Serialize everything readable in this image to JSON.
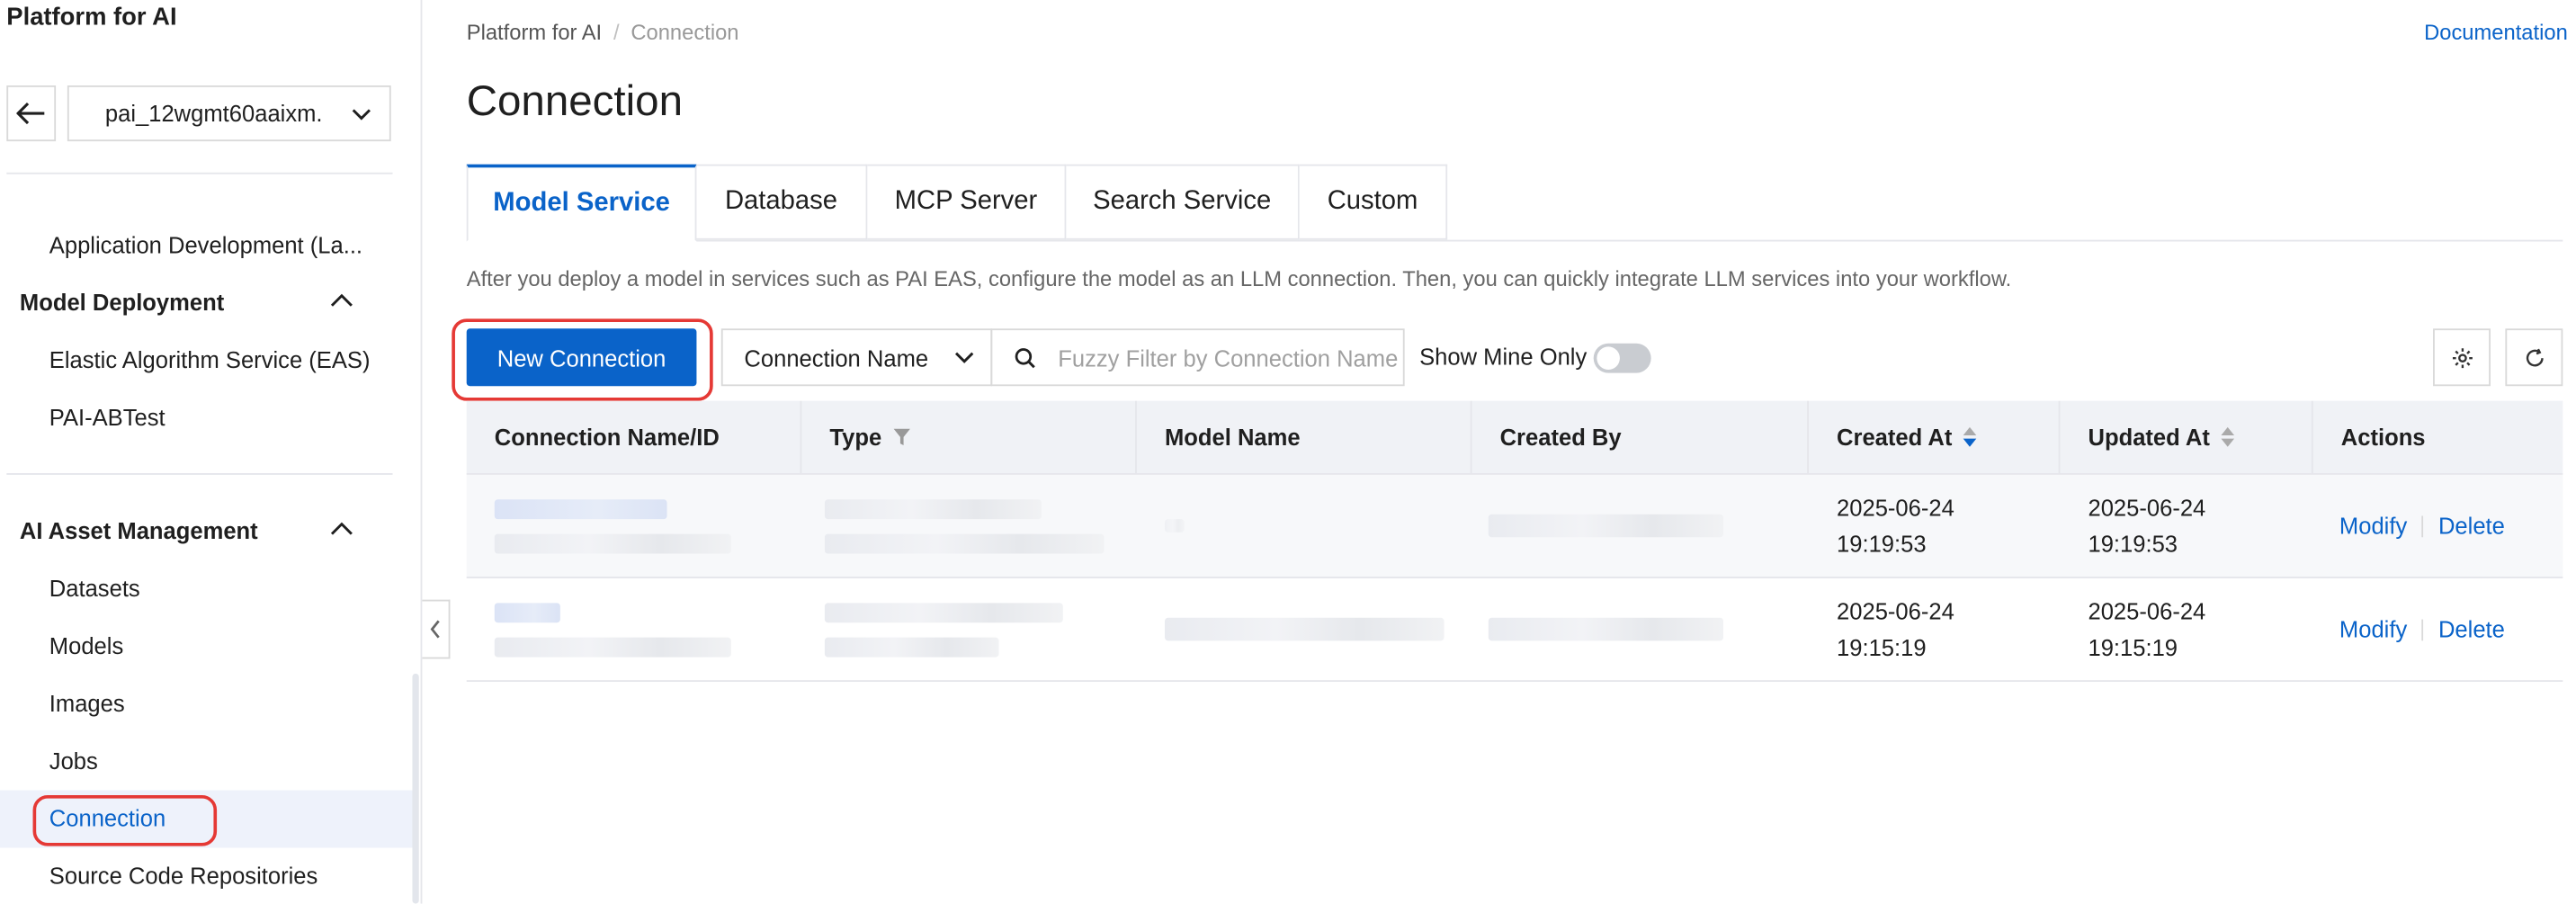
{
  "app": {
    "title": "Platform for AI"
  },
  "workspace": {
    "selected": "pai_12wgmt60aaixm."
  },
  "sidebar": {
    "items": [
      {
        "label": "Application Development (La..."
      },
      {
        "label": "Model Deployment"
      },
      {
        "label": "Elastic Algorithm Service (EAS)"
      },
      {
        "label": "PAI-ABTest"
      },
      {
        "label": "AI Asset Management"
      },
      {
        "label": "Datasets"
      },
      {
        "label": "Models"
      },
      {
        "label": "Images"
      },
      {
        "label": "Jobs"
      },
      {
        "label": "Connection"
      },
      {
        "label": "Source Code Repositories"
      }
    ]
  },
  "breadcrumb": {
    "root": "Platform for AI",
    "current": "Connection"
  },
  "header": {
    "doc_link": "Documentation",
    "title": "Connection"
  },
  "tabs": [
    {
      "label": "Model Service"
    },
    {
      "label": "Database"
    },
    {
      "label": "MCP Server"
    },
    {
      "label": "Search Service"
    },
    {
      "label": "Custom"
    }
  ],
  "description": "After you deploy a model in services such as PAI EAS, configure the model as an LLM connection. Then, you can quickly integrate LLM services into your workflow.",
  "toolbar": {
    "new_button": "New Connection",
    "filter_field": "Connection Name",
    "search_placeholder": "Fuzzy Filter by Connection Name",
    "show_mine_label": "Show Mine Only",
    "show_mine_on": false
  },
  "table": {
    "columns": [
      "Connection Name/ID",
      "Type",
      "Model Name",
      "Created By",
      "Created At",
      "Updated At",
      "Actions"
    ],
    "rows": [
      {
        "created_date": "2025-06-24",
        "created_time": "19:19:53",
        "updated_date": "2025-06-24",
        "updated_time": "19:19:53",
        "modify": "Modify",
        "delete": "Delete"
      },
      {
        "created_date": "2025-06-24",
        "created_time": "19:15:19",
        "updated_date": "2025-06-24",
        "updated_time": "19:15:19",
        "modify": "Modify",
        "delete": "Delete"
      }
    ]
  },
  "colors": {
    "accent": "#0a63c9",
    "highlight": "#e53935"
  }
}
